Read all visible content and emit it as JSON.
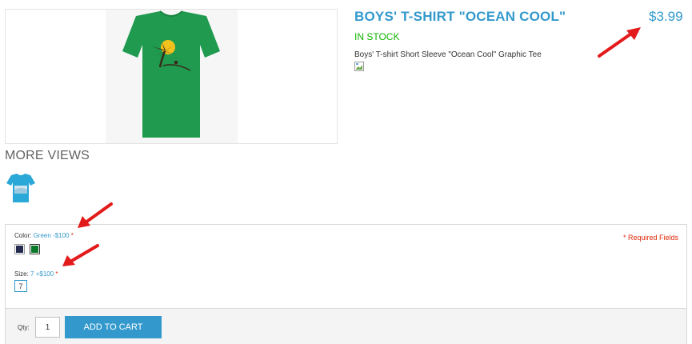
{
  "product": {
    "name": "BOYS' T-SHIRT \"OCEAN COOL\"",
    "price": "$3.99",
    "availability": "IN STOCK",
    "short_description": "Boys' T-shirt Short Sleeve \"Ocean Cool\" Graphic Tee"
  },
  "gallery": {
    "more_views_heading": "MORE VIEWS"
  },
  "options": {
    "required_note": "* Required Fields",
    "color": {
      "label": "Color:",
      "selected_value": "Green -$100",
      "required_mark": "*",
      "swatches": [
        {
          "name": "navy",
          "color": "#232a4d"
        },
        {
          "name": "green",
          "color": "#0a7a2a"
        }
      ]
    },
    "size": {
      "label": "Size:",
      "selected_value": "7 +$100",
      "required_mark": "*",
      "swatches": [
        "7"
      ]
    }
  },
  "cart": {
    "qty_label": "Qty:",
    "qty_value": "1",
    "add_to_cart_label": "ADD TO CART"
  },
  "colors": {
    "accent": "#3399cc",
    "in_stock": "#11b400",
    "required": "#df280a",
    "annotation_arrow": "#e31a1a",
    "shirt_main": "#1f9a4f",
    "thumb_shirt": "#2aa8d8"
  }
}
